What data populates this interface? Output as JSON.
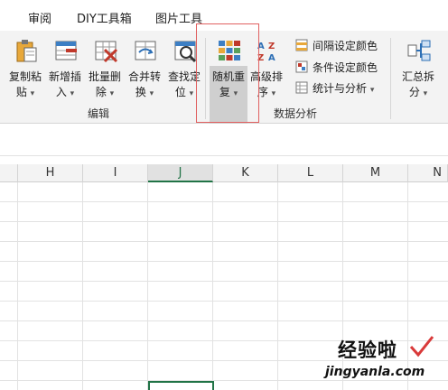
{
  "tabs": [
    "审阅",
    "DIY工具箱",
    "图片工具"
  ],
  "ribbon": {
    "buttons": [
      {
        "line1": "复制粘",
        "line2": "贴"
      },
      {
        "line1": "新增插",
        "line2": "入"
      },
      {
        "line1": "批量删",
        "line2": "除"
      },
      {
        "line1": "合并转",
        "line2": "换"
      },
      {
        "line1": "查找定",
        "line2": "位"
      },
      {
        "line1": "随机重",
        "line2": "复"
      },
      {
        "line1": "高级排",
        "line2": "序"
      },
      {
        "line1": "汇总拆",
        "line2": "分"
      }
    ],
    "small_buttons": [
      "间隔设定颜色",
      "条件设定颜色",
      "统计与分析"
    ],
    "groups": [
      "编辑",
      "数据分析"
    ]
  },
  "sheet": {
    "columns": [
      "H",
      "I",
      "J",
      "K",
      "L",
      "M",
      "N"
    ],
    "selected_column": "J"
  },
  "watermark": {
    "title": "经验啦",
    "url": "jingyanla.com"
  },
  "colors": {
    "accent": "#217346",
    "highlight": "#e06060"
  }
}
